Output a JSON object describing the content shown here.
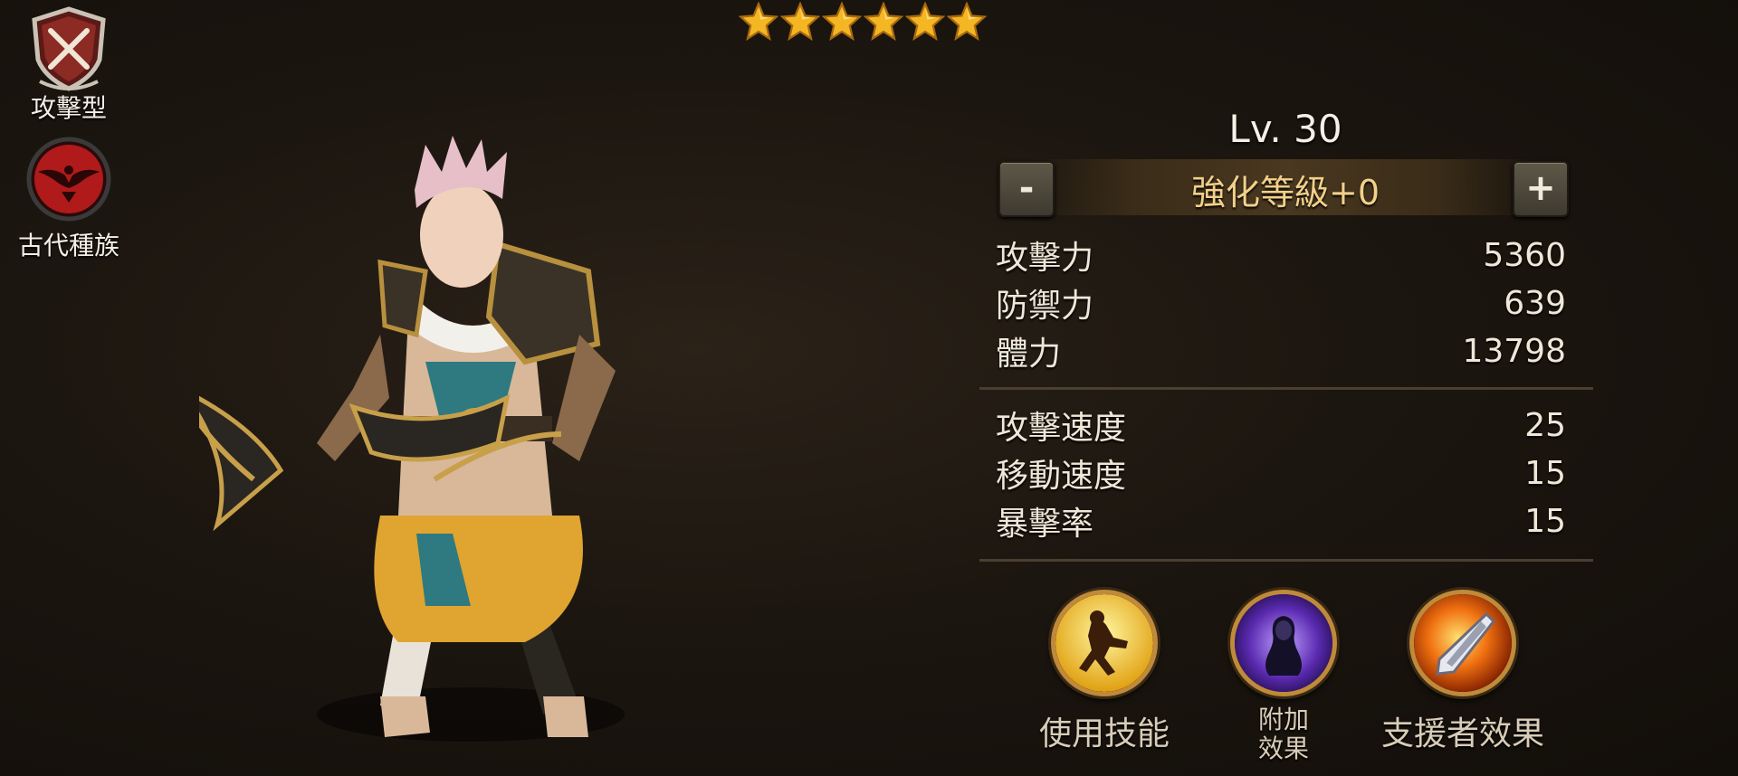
{
  "hero": {
    "stars": 6,
    "class_label": "攻擊型",
    "race_label": "古代種族",
    "level": "Lv. 30",
    "enhance_label": "強化等級+0",
    "minus_label": "-",
    "plus_label": "+"
  },
  "stats_primary": [
    {
      "name": "攻擊力",
      "value": "5360"
    },
    {
      "name": "防禦力",
      "value": "639"
    },
    {
      "name": "體力",
      "value": "13798"
    }
  ],
  "stats_secondary": [
    {
      "name": "攻擊速度",
      "value": "25"
    },
    {
      "name": "移動速度",
      "value": "15"
    },
    {
      "name": "暴擊率",
      "value": "15"
    }
  ],
  "skills": {
    "use_skill": "使用技能",
    "extra_effect_line1": "附加",
    "extra_effect_line2": "效果",
    "support_effect": "支援者效果"
  },
  "colors": {
    "star": "#f5b623",
    "enhance_text": "#f1d08a",
    "skill_ring": "#c08a3a",
    "race_badge": "#b01a1a"
  },
  "icons": {
    "class": "crossed-swords-shield-icon",
    "race": "winged-emblem-icon",
    "skill1": "running-figure-icon",
    "skill2": "spectral-figure-icon",
    "skill3": "flaming-blade-icon"
  }
}
